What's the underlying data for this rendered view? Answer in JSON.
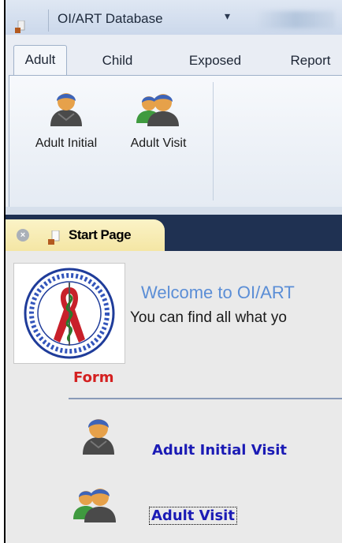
{
  "window": {
    "title": "OI/ART Database",
    "qat_glyph": "▾"
  },
  "ribbon": {
    "tabs": [
      {
        "label": "Adult",
        "active": true
      },
      {
        "label": "Child",
        "active": false
      },
      {
        "label": "Exposed",
        "active": false
      },
      {
        "label": "Report",
        "active": false
      }
    ],
    "buttons": [
      {
        "label": "Adult Initial",
        "icon": "single-user-icon"
      },
      {
        "label": "Adult Visit",
        "icon": "two-users-icon"
      }
    ]
  },
  "document_tab": {
    "title": "Start Page",
    "close_glyph": "×"
  },
  "start_page": {
    "welcome": "Welcome to OI/ART",
    "subtext": "You can find all what yo",
    "form_heading": "Form",
    "links": [
      {
        "label": "Adult Initial Visit",
        "icon": "single-user-icon"
      },
      {
        "label": "Adult Visit",
        "icon": "two-users-icon"
      }
    ]
  },
  "colors": {
    "link": "#1b1bb5",
    "heading": "#d42020",
    "welcome": "#5b8ed6",
    "doc_strip": "#1f3152",
    "doc_tab": "#f4e6a4"
  }
}
